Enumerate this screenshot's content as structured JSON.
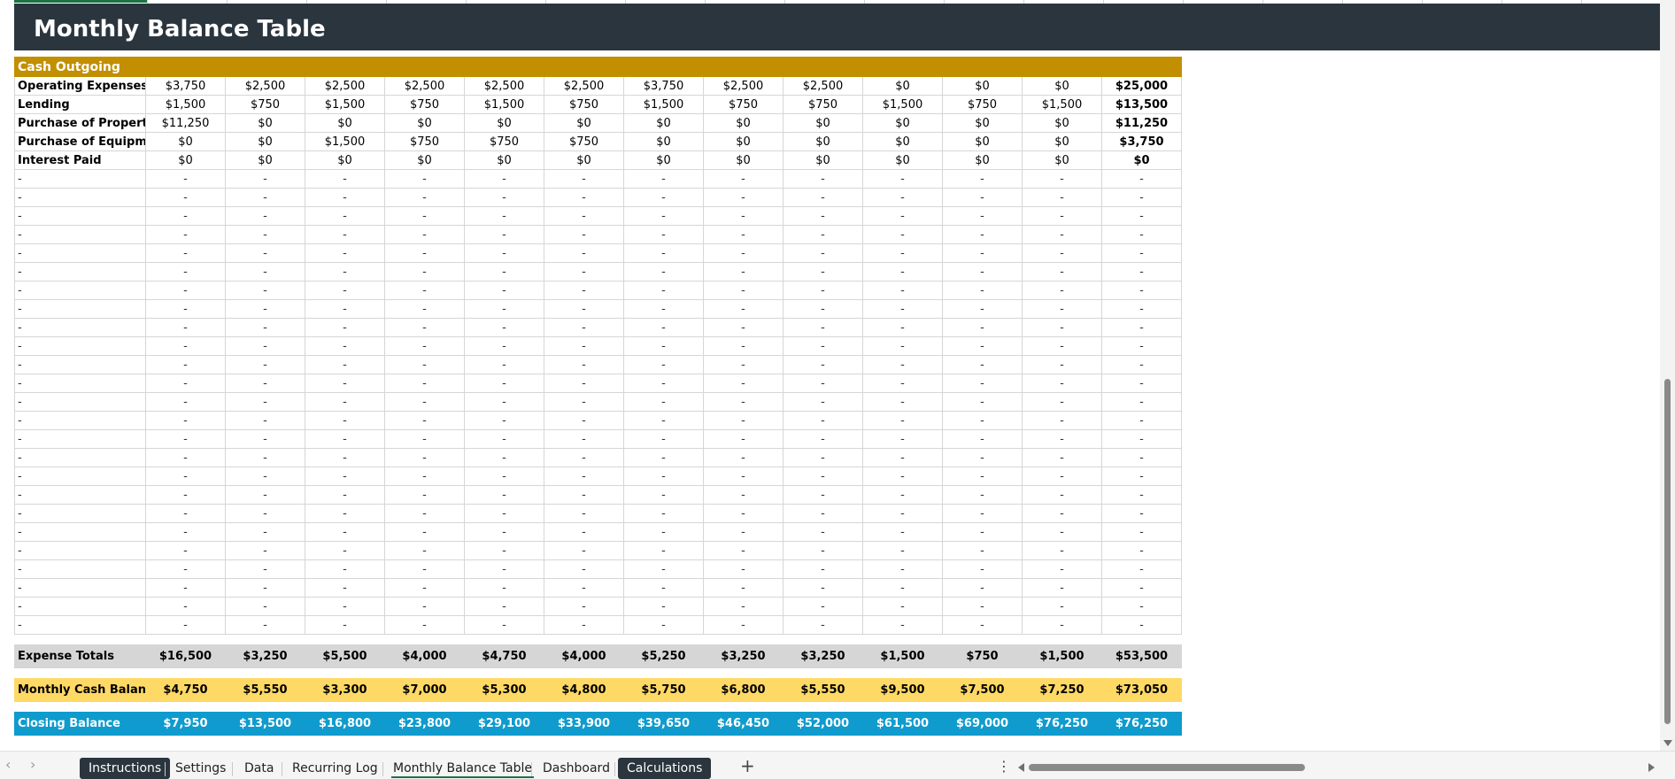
{
  "title": "Monthly Balance Table",
  "section_header": "Cash Outgoing",
  "rows": [
    {
      "label": "Operating Expenses",
      "values": [
        "$3,750",
        "$2,500",
        "$2,500",
        "$2,500",
        "$2,500",
        "$2,500",
        "$3,750",
        "$2,500",
        "$2,500",
        "$0",
        "$0",
        "$0",
        "$25,000"
      ]
    },
    {
      "label": "Lending",
      "values": [
        "$1,500",
        "$750",
        "$1,500",
        "$750",
        "$1,500",
        "$750",
        "$1,500",
        "$750",
        "$750",
        "$1,500",
        "$750",
        "$1,500",
        "$13,500"
      ]
    },
    {
      "label": "Purchase of Property",
      "values": [
        "$11,250",
        "$0",
        "$0",
        "$0",
        "$0",
        "$0",
        "$0",
        "$0",
        "$0",
        "$0",
        "$0",
        "$0",
        "$11,250"
      ]
    },
    {
      "label": "Purchase of Equipment",
      "values": [
        "$0",
        "$0",
        "$1,500",
        "$750",
        "$750",
        "$750",
        "$0",
        "$0",
        "$0",
        "$0",
        "$0",
        "$0",
        "$3,750"
      ]
    },
    {
      "label": "Interest Paid",
      "values": [
        "$0",
        "$0",
        "$0",
        "$0",
        "$0",
        "$0",
        "$0",
        "$0",
        "$0",
        "$0",
        "$0",
        "$0",
        "$0"
      ]
    }
  ],
  "blank_cell": "-",
  "blank_row_count": 25,
  "expense_totals": {
    "label": "Expense Totals",
    "values": [
      "$16,500",
      "$3,250",
      "$5,500",
      "$4,000",
      "$4,750",
      "$4,000",
      "$5,250",
      "$3,250",
      "$3,250",
      "$1,500",
      "$750",
      "$1,500",
      "$53,500"
    ]
  },
  "monthly_cash_balance": {
    "label": "Monthly Cash Balance",
    "values": [
      "$4,750",
      "$5,550",
      "$3,300",
      "$7,000",
      "$5,300",
      "$4,800",
      "$5,750",
      "$6,800",
      "$5,550",
      "$9,500",
      "$7,500",
      "$7,250",
      "$73,050"
    ]
  },
  "closing_balance": {
    "label": "Closing Balance",
    "values": [
      "$7,950",
      "$13,500",
      "$16,800",
      "$23,800",
      "$29,100",
      "$33,900",
      "$39,650",
      "$46,450",
      "$52,000",
      "$61,500",
      "$69,000",
      "$76,250",
      "$76,250"
    ]
  },
  "sheet_tabs": [
    {
      "label": "Instructions",
      "style": "dark"
    },
    {
      "label": "Settings",
      "style": "plain"
    },
    {
      "label": "Data",
      "style": "plain"
    },
    {
      "label": "Recurring Log",
      "style": "plain"
    },
    {
      "label": "Monthly Balance Table",
      "style": "active"
    },
    {
      "label": "Dashboard",
      "style": "plain"
    },
    {
      "label": "Calculations",
      "style": "dark"
    }
  ],
  "icons": {
    "prev": "chevron-left-icon",
    "next": "chevron-right-icon",
    "add": "plus-icon",
    "more": "more-vertical-icon"
  },
  "colors": {
    "title_bar": "#2b353e",
    "section_header": "#c18f00",
    "totals": "#d6d6d6",
    "monthly_balance": "#ffd966",
    "closing_balance": "#0f9bcd",
    "active_tab": "#1e7145"
  }
}
